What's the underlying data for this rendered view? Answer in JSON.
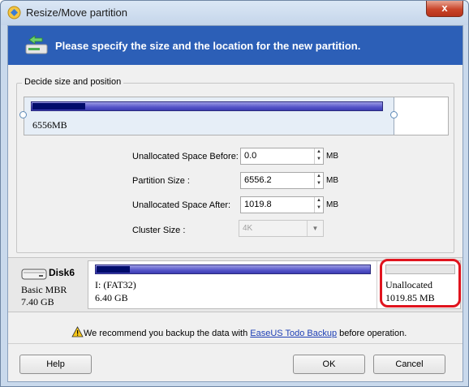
{
  "window": {
    "title": "Resize/Move partition",
    "close": "x"
  },
  "banner": {
    "text": "Please specify the size and the location for the new partition."
  },
  "group": {
    "title": "Decide size and position"
  },
  "partition_preview": {
    "size_label": "6556MB",
    "used_fraction": 0.15
  },
  "fields": {
    "before": {
      "label": "Unallocated Space Before:",
      "value": "0.0",
      "unit": "MB"
    },
    "size": {
      "label": "Partition Size :",
      "value": "6556.2",
      "unit": "MB"
    },
    "after": {
      "label": "Unallocated Space After:",
      "value": "1019.8",
      "unit": "MB"
    },
    "cluster": {
      "label": "Cluster Size :",
      "value": "4K"
    }
  },
  "disk": {
    "name": "Disk6",
    "type": "Basic MBR",
    "capacity": "7.40 GB",
    "partition_label": "I: (FAT32)",
    "partition_size": "6.40 GB",
    "partition_used_fraction": 0.12,
    "unalloc_label": "Unallocated",
    "unalloc_size": "1019.85 MB"
  },
  "notice": {
    "prefix": "We recommend you backup the data with ",
    "link": "EaseUS Todo Backup",
    "suffix": " before operation."
  },
  "buttons": {
    "help": "Help",
    "ok": "OK",
    "cancel": "Cancel"
  },
  "colors": {
    "banner": "#2c5fb7",
    "bar_used": "#000c6b",
    "bar_free": "#5555c9",
    "highlight": "#e0141e"
  }
}
